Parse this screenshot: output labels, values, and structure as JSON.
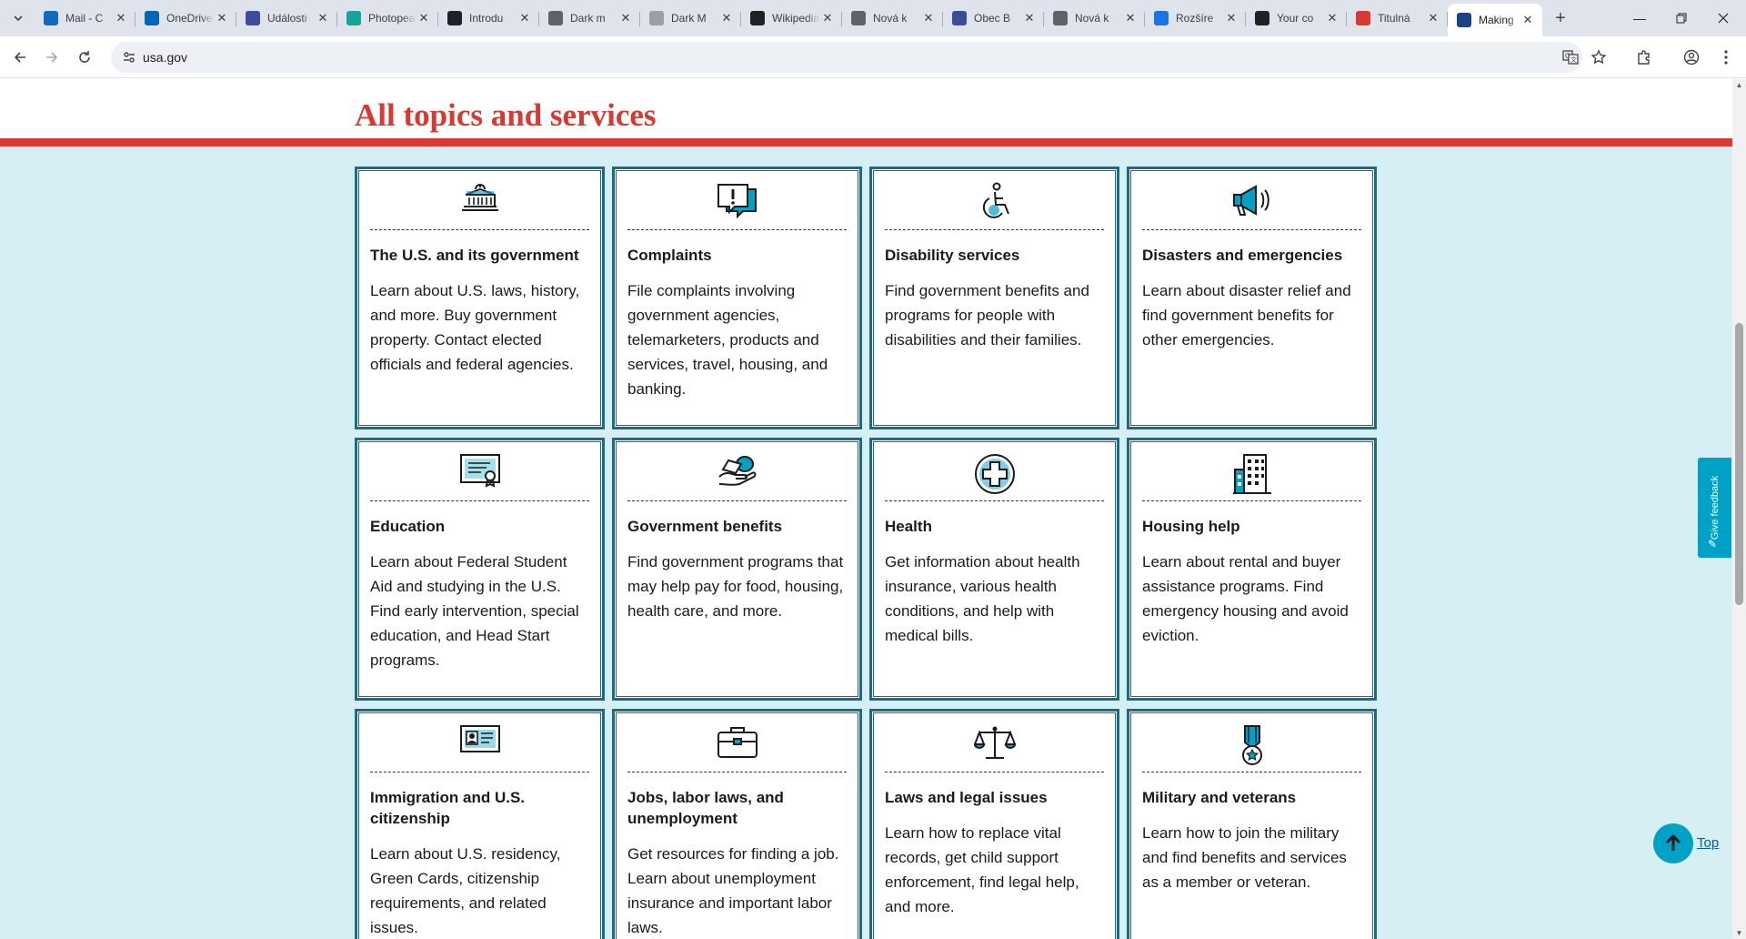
{
  "browser": {
    "tabs": [
      {
        "title": "Mail - C",
        "fav_color": "#0f6cbd",
        "fav_icon": "outlook-icon"
      },
      {
        "title": "OneDrive",
        "fav_color": "#0364b8",
        "fav_icon": "cloud-icon"
      },
      {
        "title": "Události",
        "fav_color": "#3b4c9b",
        "fav_icon": "crest-icon"
      },
      {
        "title": "Photopea",
        "fav_color": "#18a497",
        "fav_icon": "photopea-icon"
      },
      {
        "title": "Introdu",
        "fav_color": "#202124",
        "fav_icon": "github-icon"
      },
      {
        "title": "Dark m",
        "fav_color": "#5f6368",
        "fav_icon": "chrome-settings-icon"
      },
      {
        "title": "Dark M",
        "fav_color": "#9aa0a6",
        "fav_icon": "globe-icon"
      },
      {
        "title": "Wikipedia",
        "fav_color": "#202124",
        "fav_icon": "wikipedia-icon"
      },
      {
        "title": "Nová k",
        "fav_color": "#5f6368",
        "fav_icon": "chrome-icon"
      },
      {
        "title": "Obec B",
        "fav_color": "#3b4c9b",
        "fav_icon": "crest-icon"
      },
      {
        "title": "Nová k",
        "fav_color": "#5f6368",
        "fav_icon": "chrome-icon"
      },
      {
        "title": "Rozšíre",
        "fav_color": "#1a73e8",
        "fav_icon": "puzzle-icon"
      },
      {
        "title": "Your co",
        "fav_color": "#202124",
        "fav_icon": "notion-icon"
      },
      {
        "title": "Titulná",
        "fav_color": "#d83933",
        "fav_icon": "sk-icon"
      },
      {
        "title": "Making",
        "fav_color": "#1a4480",
        "fav_icon": "usagov-icon",
        "active": true
      }
    ],
    "url": "usa.gov"
  },
  "page": {
    "section_title": "All topics and services",
    "cards": [
      {
        "icon": "capitol-building-icon",
        "title": "The U.S. and its government",
        "desc": "Learn about U.S. laws, history, and more. Buy government property. Contact elected officials and federal agencies."
      },
      {
        "icon": "complaint-speech-bubble-icon",
        "title": "Complaints",
        "desc": "File complaints involving government agencies, telemarketers, products and services, travel, housing, and banking."
      },
      {
        "icon": "wheelchair-icon",
        "title": "Disability services",
        "desc": "Find government benefits and programs for people with disabilities and their families."
      },
      {
        "icon": "megaphone-icon",
        "title": "Disasters and emergencies",
        "desc": "Learn about disaster relief and find government benefits for other emergencies."
      },
      {
        "icon": "diploma-certificate-icon",
        "title": "Education",
        "desc": "Learn about Federal Student Aid and studying in the U.S. Find early intervention, special education, and Head Start programs."
      },
      {
        "icon": "hand-money-icon",
        "title": "Government benefits",
        "desc": "Find government programs that may help pay for food, housing, health care, and more."
      },
      {
        "icon": "medical-cross-icon",
        "title": "Health",
        "desc": "Get information about health insurance, various health conditions, and help with medical bills."
      },
      {
        "icon": "apartment-building-icon",
        "title": "Housing help",
        "desc": "Learn about rental and buyer assistance programs. Find emergency housing and avoid eviction."
      },
      {
        "icon": "id-card-icon",
        "title": "Immigration and U.S. citizenship",
        "desc": "Learn about U.S. residency, Green Cards, citizenship requirements, and related issues."
      },
      {
        "icon": "briefcase-icon",
        "title": "Jobs, labor laws, and unemployment",
        "desc": "Get resources for finding a job. Learn about unemployment insurance and important labor laws."
      },
      {
        "icon": "scales-of-justice-icon",
        "title": "Laws and legal issues",
        "desc": "Learn how to replace vital records, get child support enforcement, find legal help, and more."
      },
      {
        "icon": "military-medal-icon",
        "title": "Military and veterans",
        "desc": "Learn how to join the military and find benefits and services as a member or veteran."
      }
    ],
    "feedback_label": "Give feedback",
    "top_label": "Top"
  },
  "colors": {
    "accent_red": "#d83933",
    "card_border": "#1b6b85",
    "background": "#d6eff4",
    "cyan": "#00a1c7"
  }
}
